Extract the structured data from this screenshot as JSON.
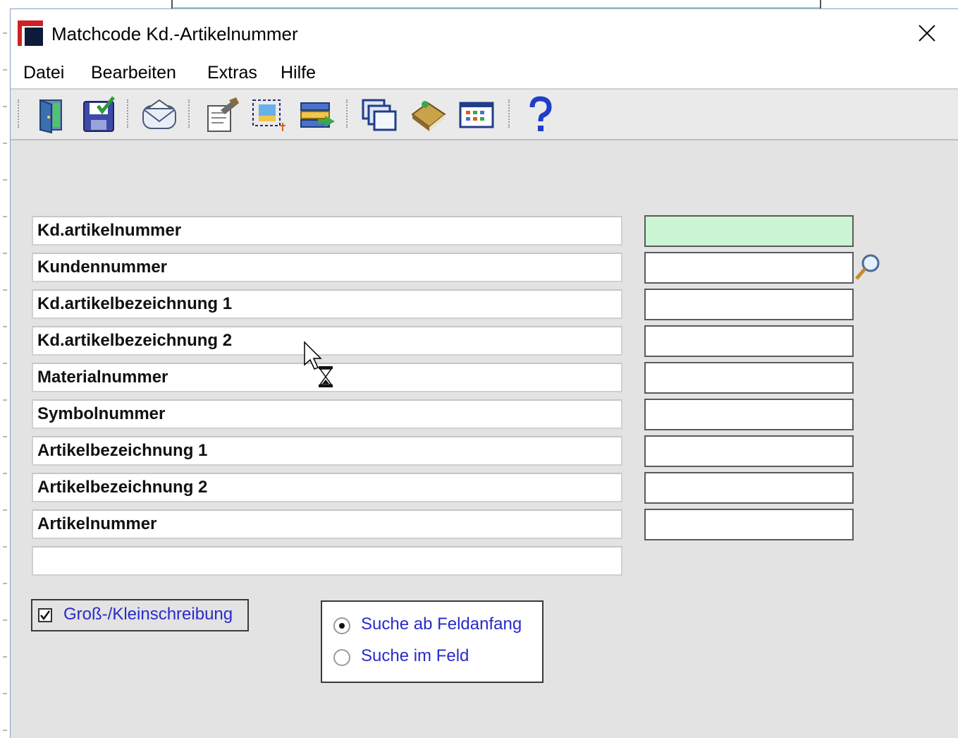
{
  "window": {
    "title": "Matchcode Kd.-Artikelnummer"
  },
  "menu": {
    "items": [
      "Datei",
      "Bearbeiten",
      "Extras",
      "Hilfe"
    ]
  },
  "toolbar": {
    "buttons": [
      {
        "icon": "exit-door-icon"
      },
      {
        "icon": "save-icon"
      },
      {
        "icon": "mail-icon"
      },
      {
        "icon": "edit-document-icon"
      },
      {
        "icon": "select-area-icon"
      },
      {
        "icon": "transfer-list-icon"
      },
      {
        "icon": "windows-cascade-icon"
      },
      {
        "icon": "book-icon"
      },
      {
        "icon": "table-grid-icon"
      },
      {
        "icon": "help-icon"
      }
    ]
  },
  "form": {
    "fields": [
      {
        "label": "Kd.artikelnummer",
        "value": "",
        "active": true
      },
      {
        "label": "Kundennummer",
        "value": "",
        "has_lookup": true
      },
      {
        "label": "Kd.artikelbezeichnung 1",
        "value": ""
      },
      {
        "label": "Kd.artikelbezeichnung 2",
        "value": ""
      },
      {
        "label": "Materialnummer",
        "value": ""
      },
      {
        "label": "Symbolnummer",
        "value": ""
      },
      {
        "label": "Artikelbezeichnung 1",
        "value": ""
      },
      {
        "label": "Artikelbezeichnung 2",
        "value": ""
      },
      {
        "label": "Artikelnummer",
        "value": ""
      },
      {
        "label": ""
      }
    ],
    "case_sensitive": {
      "label": "Groß-/Kleinschreibung",
      "checked": true
    },
    "search_mode": {
      "options": [
        "Suche ab Feldanfang",
        "Suche im Feld"
      ],
      "selected": "Suche ab Feldanfang"
    }
  },
  "colors": {
    "active_field": "#ccf5d6",
    "option_text": "#2a2acb",
    "window_bg": "#e3e3e3"
  }
}
